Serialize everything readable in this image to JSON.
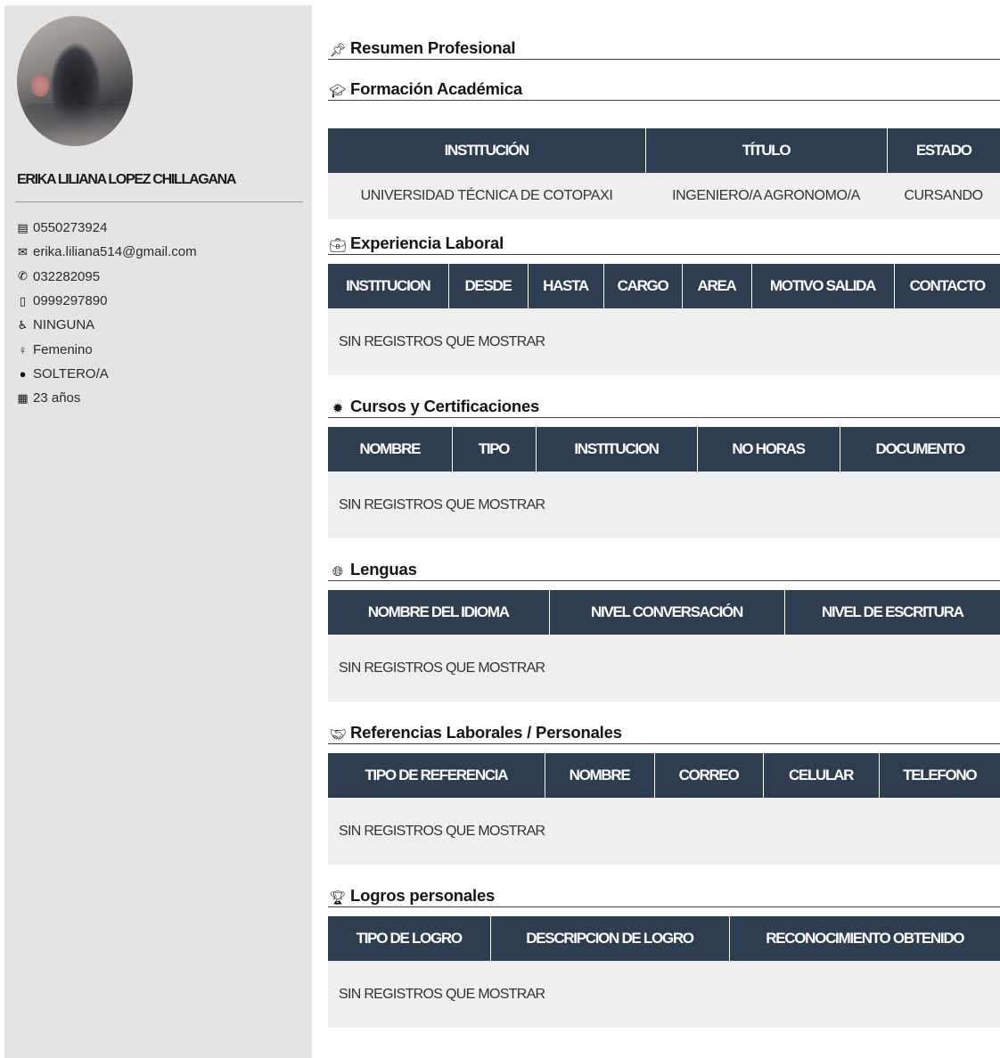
{
  "profile": {
    "name": "ERIKA LILIANA LOPEZ CHILLAGANA",
    "contacts": [
      {
        "icon": "id-card-icon",
        "glyph": "▤",
        "value": "0550273924"
      },
      {
        "icon": "envelope-icon",
        "glyph": "✉",
        "value": "erika.liliana514@gmail.com"
      },
      {
        "icon": "phone-icon",
        "glyph": "✆",
        "value": "032282095"
      },
      {
        "icon": "mobile-icon",
        "glyph": "▯",
        "value": "0999297890"
      },
      {
        "icon": "wheelchair-icon",
        "glyph": "♿",
        "value": "NINGUNA"
      },
      {
        "icon": "female-icon",
        "glyph": "♀",
        "value": "Femenino"
      },
      {
        "icon": "user-icon",
        "glyph": "●",
        "value": "SOLTERO/A"
      },
      {
        "icon": "calendar-icon",
        "glyph": "▦",
        "value": "23 años"
      }
    ]
  },
  "sections": {
    "resumen": {
      "title": "Resumen Profesional",
      "icon": "pin-icon"
    },
    "formacion": {
      "title": "Formación Académica",
      "icon": "graduation-cap-icon",
      "headers": [
        "INSTITUCIÓN",
        "TÍTULO",
        "ESTADO"
      ],
      "rows": [
        [
          "UNIVERSIDAD TÉCNICA DE COTOPAXI",
          "INGENIERO/A AGRONOMO/A",
          "CURSANDO"
        ]
      ]
    },
    "experiencia": {
      "title": "Experiencia Laboral",
      "icon": "briefcase-icon",
      "headers": [
        "INSTITUCION",
        "DESDE",
        "HASTA",
        "CARGO",
        "AREA",
        "MOTIVO SALIDA",
        "CONTACTO"
      ],
      "empty": "SIN REGISTROS QUE MOSTRAR"
    },
    "cursos": {
      "title": "Cursos y Certificaciones",
      "icon": "certificate-icon",
      "headers": [
        "NOMBRE",
        "TIPO",
        "INSTITUCION",
        "NO HORAS",
        "DOCUMENTO"
      ],
      "empty": "SIN REGISTROS QUE MOSTRAR"
    },
    "lenguas": {
      "title": "Lenguas",
      "icon": "globe-icon",
      "headers": [
        "NOMBRE DEL IDIOMA",
        "NIVEL CONVERSACIÓN",
        "NIVEL DE ESCRITURA"
      ],
      "empty": "SIN REGISTROS QUE MOSTRAR"
    },
    "referencias": {
      "title": "Referencias Laborales / Personales",
      "icon": "handshake-icon",
      "headers": [
        "TIPO DE REFERENCIA",
        "NOMBRE",
        "CORREO",
        "CELULAR",
        "TELEFONO"
      ],
      "empty": "SIN REGISTROS QUE MOSTRAR"
    },
    "logros": {
      "title": "Logros personales",
      "icon": "trophy-icon",
      "headers": [
        "TIPO DE LOGRO",
        "DESCRIPCION DE LOGRO",
        "RECONOCIMIENTO OBTENIDO"
      ],
      "empty": "SIN REGISTROS QUE MOSTRAR"
    }
  },
  "colors": {
    "sidebar_bg": "#e4e4e4",
    "table_header_bg": "#2e3e50",
    "table_body_bg": "#efefef"
  }
}
